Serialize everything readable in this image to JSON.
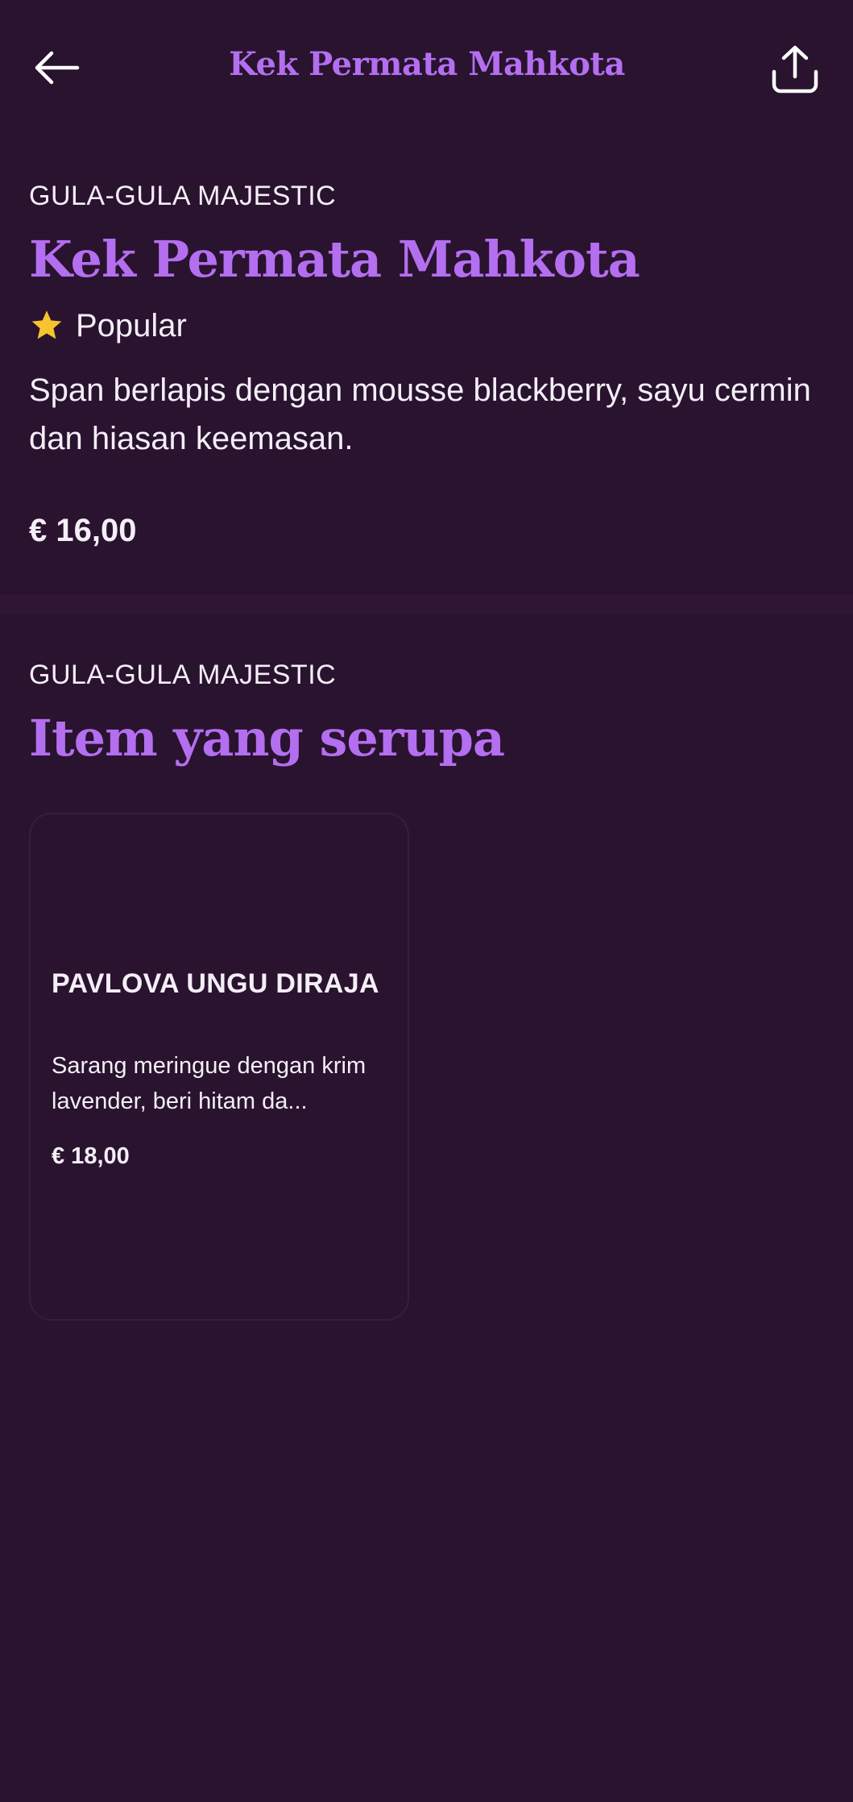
{
  "header": {
    "title": "Kek Permata Mahkota",
    "back_icon": "arrow-left-icon",
    "share_icon": "share-upload-icon"
  },
  "product": {
    "brand": "GULA-GULA MAJESTIC",
    "title": "Kek Permata Mahkota",
    "badge_icon": "star-icon",
    "badge_label": "Popular",
    "description": "Span berlapis dengan mousse blackberry, sayu cermin dan hiasan keemasan.",
    "price": "€ 16,00"
  },
  "similar": {
    "brand": "GULA-GULA MAJESTIC",
    "title": "Item yang serupa",
    "items": [
      {
        "name": "PAVLOVA UNGU DIRAJA",
        "description": "Sarang meringue dengan krim lavender, beri hitam da...",
        "price": "€ 18,00"
      }
    ]
  },
  "colors": {
    "background": "#29132e",
    "accent": "#b46ef0",
    "text": "#f4eef7",
    "star": "#f7c32e",
    "divider": "#2e1634"
  }
}
